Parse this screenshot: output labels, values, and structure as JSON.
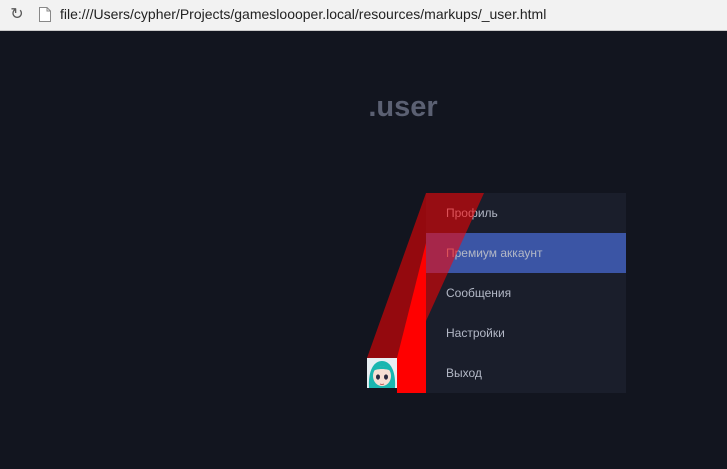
{
  "browser": {
    "reload_icon": "reload-icon",
    "page_icon": "document-icon",
    "url": "file:///Users/cypher/Projects/gamesloooper.local/resources/markups/_user.html"
  },
  "page": {
    "title": ".user"
  },
  "menu": {
    "items": [
      {
        "label": "Профиль",
        "active": false
      },
      {
        "label": "Премиум аккаунт",
        "active": true
      },
      {
        "label": "Сообщения",
        "active": false
      },
      {
        "label": "Настройки",
        "active": false
      },
      {
        "label": "Выход",
        "active": false
      }
    ]
  },
  "colors": {
    "background": "#12151f",
    "menu_background": "#1a1e2b",
    "active_item": "#3b55a5",
    "highlight": "#ff0000",
    "title": "#5b6072"
  }
}
